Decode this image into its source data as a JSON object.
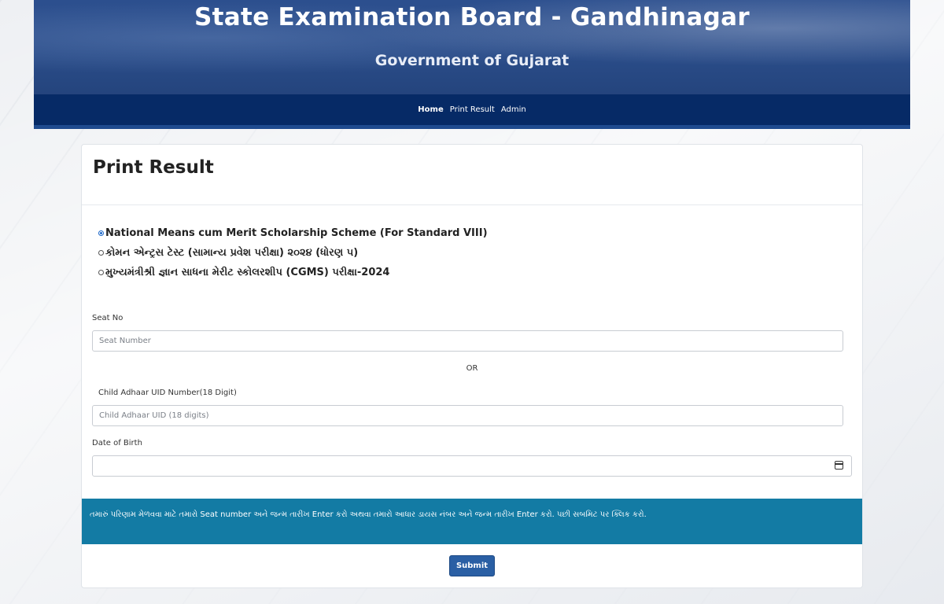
{
  "header": {
    "title": "State Examination Board - Gandhinagar",
    "subtitle": "Government of Gujarat"
  },
  "nav": {
    "items": [
      {
        "label": "Home",
        "active": true
      },
      {
        "label": "Print Result",
        "active": false
      },
      {
        "label": "Admin",
        "active": false
      }
    ]
  },
  "card": {
    "title": "Print Result",
    "exam_options": [
      {
        "label": "National Means cum Merit Scholarship Scheme (For Standard VIII)",
        "checked": true
      },
      {
        "label": "કોમન એન્ટ્રસ ટેસ્ટ (સામાન્ય પ્રવેશ પરીક્ષા) ૨૦૨૪ (ધોરણ ૫)",
        "checked": false
      },
      {
        "label": "મુખ્યમંત્રીશ્રી જ્ઞાન સાધના મેરીટ સ્કોલરશીપ (CGMS) પરીક્ષા-2024",
        "checked": false
      }
    ],
    "seat_label": "Seat No",
    "seat_placeholder": "Seat Number",
    "or_text": "OR",
    "aadhaar_label": "Child Adhaar UID Number(18 Digit)",
    "aadhaar_placeholder": "Child Adhaar UID (18 digits)",
    "dob_label": "Date of Birth",
    "dob_value": "",
    "info_text": "તમારું પરિણામ મેળવવા માટે તમારો Seat number અને જન્મ તારીખ Enter કરો અથવા તમારો આધાર ડાયસ નંબર અને જન્મ તારીખ Enter કરો. પછી સબમિટ પર ક્લિક કરો.",
    "submit_label": "Submit"
  },
  "colors": {
    "banner": "#2a4c88",
    "navbar": "#062a66",
    "info_bar": "#137ba4",
    "submit": "#2a5fa4"
  }
}
